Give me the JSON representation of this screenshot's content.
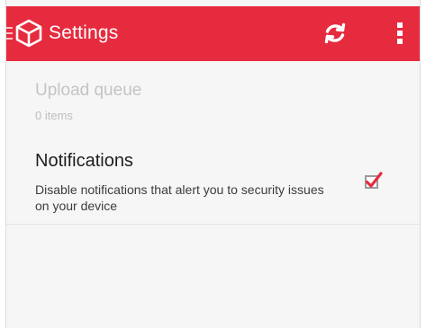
{
  "app_bar": {
    "title": "Settings",
    "bar_color": "#e62b3f",
    "icons": [
      "nav-toggle-icon",
      "app-logo-icon",
      "refresh-icon",
      "overflow-menu-icon"
    ]
  },
  "settings": {
    "upload_queue": {
      "title": "Upload queue",
      "subtitle": "0 items",
      "enabled": false
    },
    "notifications": {
      "title": "Notifications",
      "subtitle": "Disable notifications that alert you to security issues on your device",
      "checked": true,
      "check_color": "#e62b3f"
    }
  }
}
